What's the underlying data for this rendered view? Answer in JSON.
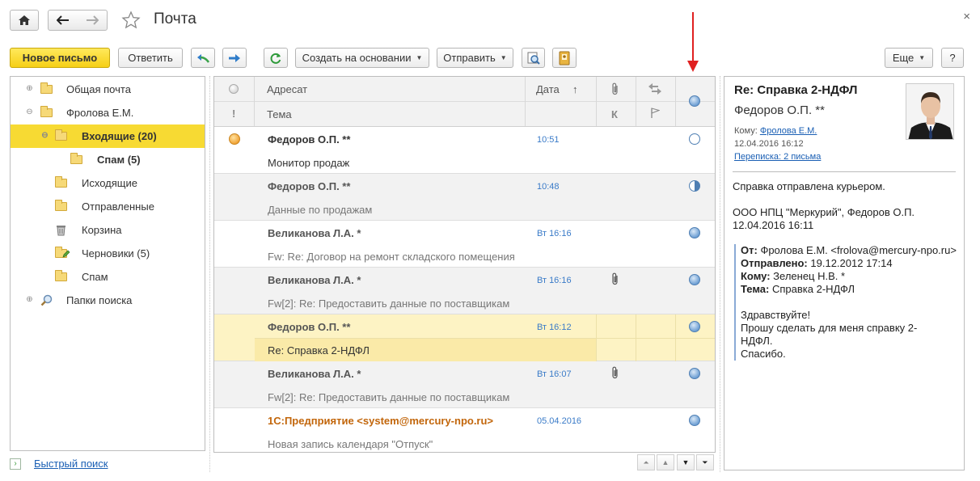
{
  "window": {
    "title": "Почта",
    "close_glyph": "×"
  },
  "toolbar": {
    "new_letter": "Новое письмо",
    "reply": "Ответить",
    "create_based": "Создать на основании",
    "send": "Отправить",
    "more": "Еще",
    "help": "?"
  },
  "tree": {
    "items": [
      {
        "label": "Общая почта"
      },
      {
        "label": "Фролова Е.М."
      },
      {
        "label": "Входящие (20)"
      },
      {
        "label": "Спам (5)"
      },
      {
        "label": "Исходящие"
      },
      {
        "label": "Отправленные"
      },
      {
        "label": "Корзина"
      },
      {
        "label": "Черновики (5)"
      },
      {
        "label": "Спам"
      },
      {
        "label": "Папки поиска"
      }
    ],
    "selected": "Входящие (20)"
  },
  "quick_search": "Быстрый поиск",
  "list": {
    "headers": {
      "addressee": "Адресат",
      "date": "Дата",
      "sort_glyph": "↑",
      "subject": "Тема",
      "importance_glyph": "!",
      "k_glyph": "К"
    },
    "rows": [
      {
        "sender": "Федоров О.П. **",
        "subject": "Монитор продаж",
        "date": "10:51",
        "attachment": false,
        "status": "empty",
        "unread": true
      },
      {
        "sender": "Федоров О.П. **",
        "subject": "Данные по продажам",
        "date": "10:48",
        "attachment": false,
        "status": "half",
        "unread": false
      },
      {
        "sender": "Великанова Л.А. *",
        "subject": "Fw: Re: Договор на ремонт складского помещения",
        "date": "Вт 16:16",
        "attachment": false,
        "status": "full",
        "unread": false
      },
      {
        "sender": "Великанова Л.А. *",
        "subject": "Fw[2]: Re: Предоставить данные по поставщикам",
        "date": "Вт 16:16",
        "attachment": true,
        "status": "full",
        "unread": false
      },
      {
        "sender": "Федоров О.П. **",
        "subject": "Re: Справка 2-НДФЛ",
        "date": "Вт 16:12",
        "attachment": false,
        "status": "full",
        "unread": false
      },
      {
        "sender": "Великанова Л.А. *",
        "subject": "Fw[2]: Re: Предоставить данные по поставщикам",
        "date": "Вт 16:07",
        "attachment": true,
        "status": "full",
        "unread": false
      },
      {
        "sender": "1С:Предприятие <system@mercury-npo.ru>",
        "subject": "Новая запись календаря \"Отпуск\"",
        "date": "05.04.2016",
        "attachment": false,
        "status": "full",
        "unread": false
      }
    ],
    "selected_index": 4
  },
  "preview": {
    "subject": "Re: Справка 2-НДФЛ",
    "from": "Федоров О.П. **",
    "to_label": "Кому:",
    "to_value": "Фролова Е.М.",
    "date": "12.04.2016 16:12",
    "thread": "Переписка: 2 письма",
    "body_line1": "Справка отправлена курьером.",
    "body_line2": "ООО НПЦ \"Меркурий\", Федоров О.П.",
    "body_line3": "12.04.2016 16:11",
    "quote_from_label": "От:",
    "quote_from": "Фролова Е.М. <frolova@mercury-npo.ru>",
    "quote_sent_label": "Отправлено:",
    "quote_sent": "19.12.2012 17:14",
    "quote_to_label": "Кому:",
    "quote_to": "Зеленец Н.В. *",
    "quote_subject_label": "Тема:",
    "quote_subject": "Справка 2-НДФЛ",
    "quote_body1": "Здравствуйте!",
    "quote_body2": "Прошу сделать для меня справку 2-",
    "quote_body3": "НДФЛ.",
    "quote_body4": "Спасибо."
  },
  "colors": {
    "accent_yellow": "#f7da33",
    "link_blue": "#1a5fb4",
    "annotation_red": "#e02020"
  }
}
